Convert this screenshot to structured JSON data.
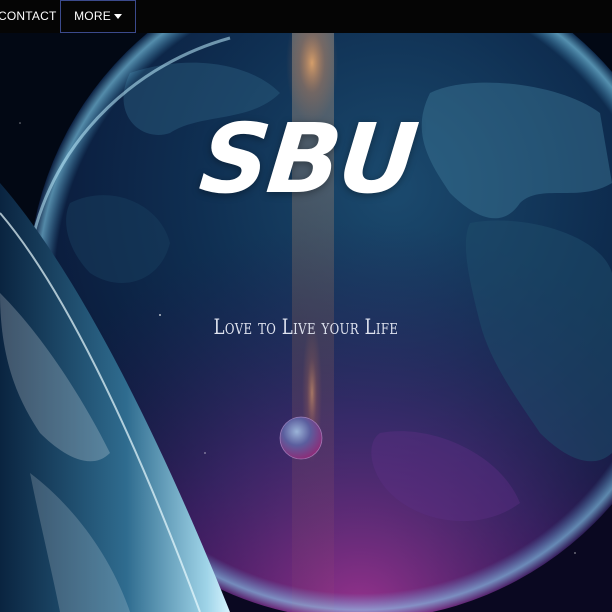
{
  "nav": {
    "contact_label": "CONTACT",
    "more_label": "MORE"
  },
  "hero": {
    "logo_text": "SBU",
    "tagline": "Love to Live your Life"
  },
  "icons": {
    "more_caret": "caret-down-icon"
  }
}
